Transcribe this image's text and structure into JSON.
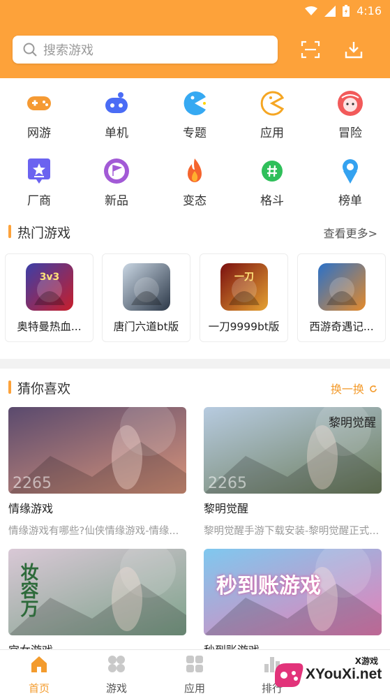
{
  "status_bar": {
    "time": "4:16"
  },
  "search": {
    "placeholder": "搜索游戏"
  },
  "categories": [
    {
      "label": "网游",
      "icon": "gamepad-icon",
      "color": "#f59a33"
    },
    {
      "label": "单机",
      "icon": "controller-icon",
      "color": "#4a6cf5"
    },
    {
      "label": "专题",
      "icon": "pacman-blue-icon",
      "color": "#36a9f2"
    },
    {
      "label": "应用",
      "icon": "pacman-outline-icon",
      "color": "#f5a623"
    },
    {
      "label": "冒险",
      "icon": "face-icon",
      "color": "#f25a5a"
    },
    {
      "label": "厂商",
      "icon": "star-badge-icon",
      "color": "#6b63f0"
    },
    {
      "label": "新品",
      "icon": "flag-icon",
      "color": "#a25ad6"
    },
    {
      "label": "变态",
      "icon": "flame-icon",
      "color": "#f5642d"
    },
    {
      "label": "格斗",
      "icon": "hashtag-icon",
      "color": "#2fbf5a"
    },
    {
      "label": "榜单",
      "icon": "person-icon",
      "color": "#34a2f0"
    }
  ],
  "hot_games": {
    "title": "热门游戏",
    "more": "查看更多>",
    "items": [
      {
        "name": "奥特曼热血...",
        "thumb_text": "3v3",
        "colors": [
          "#3b3fa8",
          "#c81e2a"
        ]
      },
      {
        "name": "唐门六道bt版",
        "thumb_text": "",
        "colors": [
          "#c9d6e3",
          "#2c3848"
        ]
      },
      {
        "name": "一刀9999bt版",
        "thumb_text": "一刀",
        "colors": [
          "#7a0f0f",
          "#e5a232"
        ]
      },
      {
        "name": "西游奇遇记...",
        "thumb_text": "",
        "colors": [
          "#2a71c9",
          "#e58a2a"
        ]
      }
    ]
  },
  "guess": {
    "title": "猜你喜欢",
    "refresh": "换一换",
    "items": [
      {
        "title": "情缘游戏",
        "desc": "情缘游戏有哪些?仙侠情缘游戏-情缘...",
        "banner_watermark": "2265",
        "colors": [
          "#5a4a6e",
          "#d8947a"
        ]
      },
      {
        "title": "黎明觉醒",
        "desc": "黎明觉醒手游下载安装-黎明觉醒正式...",
        "banner_watermark": "2265",
        "banner_text": "黎明觉醒",
        "colors": [
          "#b7cbe0",
          "#6c7d5c"
        ]
      },
      {
        "title": "宫女游戏",
        "desc": "",
        "banner_watermark": "",
        "banner_text": "妆容万",
        "colors": [
          "#d9c8d6",
          "#7da28a"
        ]
      },
      {
        "title": "秒到账游戏",
        "desc": "",
        "banner_watermark": "",
        "banner_text": "秒到账游戏",
        "colors": [
          "#7fc8ef",
          "#e77fb6"
        ]
      }
    ]
  },
  "tabs": [
    {
      "label": "首页",
      "icon": "home-icon",
      "active": true
    },
    {
      "label": "游戏",
      "icon": "grid-icon",
      "active": false
    },
    {
      "label": "应用",
      "icon": "apps-icon",
      "active": false
    },
    {
      "label": "排行",
      "icon": "ranking-icon",
      "active": false
    }
  ],
  "watermark": {
    "small": "X游戏",
    "big": "XYouXi.net"
  },
  "colors": {
    "accent": "#fda23a",
    "accent_text": "#f39b2d"
  }
}
